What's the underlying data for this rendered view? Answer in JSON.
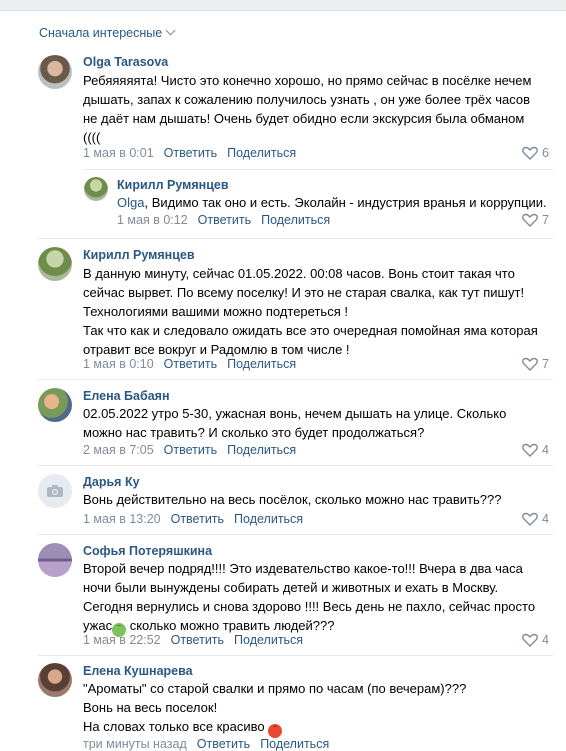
{
  "sort_label": "Сначала интересные",
  "actions": {
    "reply": "Ответить",
    "share": "Поделиться"
  },
  "comments": [
    {
      "author": "Olga Tarasova",
      "lines": [
        "Ребяяяяята! Чисто это конечно хорошо, но прямо сейчас в посёлке нечем",
        "дышать, запах к сожалению получилось узнать , он уже более трёх часов",
        "не даёт нам дышать! Очень будет обидно если экскурсия была обманом",
        "(((("
      ],
      "date": "1 мая в 0:01",
      "likes": "6"
    },
    {
      "author": "Кирилл Румянцев",
      "mention": "Olga",
      "text_after_mention": ", Видимо так оно и есть. Эколайн - индустрия вранья и коррупции.",
      "date": "1 мая в 0:12",
      "likes": "7"
    },
    {
      "author": "Кирилл Румянцев",
      "lines": [
        "В данную минуту, сейчас 01.05.2022. 00:08 часов. Вонь стоит такая что",
        "сейчас вырвет. По всему поселку! И это не старая свалка, как тут пишут!",
        "Технологиями вашими можно подтереться !",
        "Так что как и следовало ожидать все это очередная помойная яма которая",
        "отравит все вокруг и Радомлю в том числе !"
      ],
      "date": "1 мая в 0:10",
      "likes": "7"
    },
    {
      "author": "Елена Бабаян",
      "lines": [
        "02.05.2022 утро 5-30, ужасная вонь, нечем дышать на улице. Сколько",
        "можно нас травить? И сколько это будет продолжаться?"
      ],
      "date": "2 мая в 7:05",
      "likes": "4"
    },
    {
      "author": "Дарья Ку",
      "lines": [
        "Вонь действительно на весь посёлок, сколько можно нас травить???"
      ],
      "date": "1 мая в 13:20",
      "likes": "4"
    },
    {
      "author": "Софья Потеряшкина",
      "lines": [
        "Второй вечер подряд!!!! Это издевательство какое-то!!! Вчера в два часа",
        "ночи были вынуждены собирать детей и животных и ехать в Москву.",
        "Сегодня вернулись и снова здорово !!!! Весь день не пахло, сейчас просто"
      ],
      "last_line_before_emoji": "ужас",
      "last_line_after_emoji": " сколько можно травить людей???",
      "date": "1 мая в 22:52",
      "likes": "4"
    },
    {
      "author": "Елена Кушнарева",
      "lines": [
        "\"Ароматы\" со старой свалки и прямо по часам (по вечерам)???",
        "Вонь на весь поселок!"
      ],
      "last_line_before_emoji": "На словах только все красиво ",
      "date": "три минуты назад"
    }
  ],
  "colors": {
    "link": "#2a5885",
    "meta": "#818c99",
    "separator": "#e7e8ec"
  }
}
